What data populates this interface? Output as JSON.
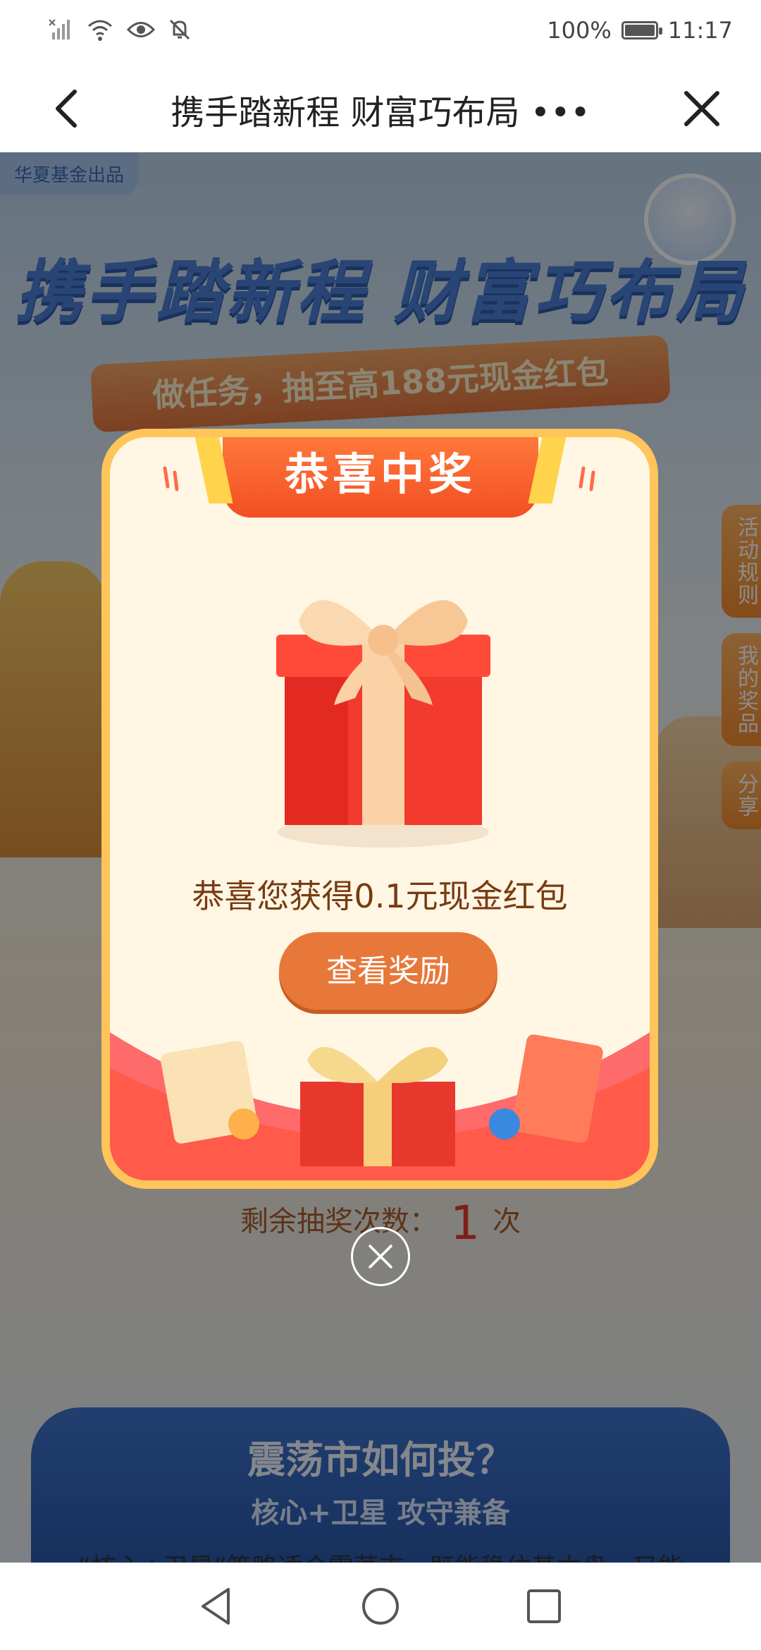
{
  "status_bar": {
    "battery": "100%",
    "time": "11:17"
  },
  "nav": {
    "title": "携手踏新程 财富巧布局 •••"
  },
  "page": {
    "brand_tag": "华夏基金出品",
    "hero_title": "携手踏新程 财富巧布局",
    "ribbon_text": "做任务，抽至高188元现金红包",
    "side_tabs": [
      "活动规则",
      "我的奖品",
      "分享"
    ],
    "remaining_label": "剩余抽奖次数：",
    "remaining_count": "1",
    "remaining_unit": "次",
    "section_title": "震荡市如何投？",
    "section_subtitle": "核心+卫星 攻守兼备",
    "section_text": "“核心+卫星”策略适合震荡市，既能稳住基本盘，又能"
  },
  "modal": {
    "header": "恭喜中奖",
    "prize_text": "恭喜您获得0.1元现金红包",
    "button_label": "查看奖励"
  },
  "colors": {
    "accent": "#e8783a",
    "header": "#f34f24",
    "border": "#ffc45a",
    "prize_text": "#7a3a12"
  }
}
